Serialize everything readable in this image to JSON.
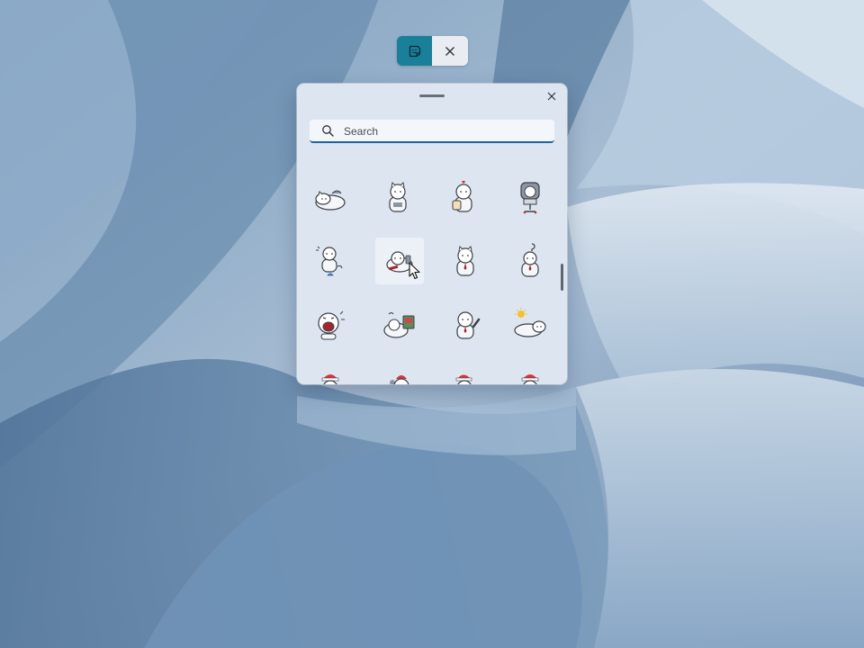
{
  "mode_toggle": {
    "active_icon": "sticker-icon",
    "close_icon": "close-icon"
  },
  "panel": {
    "close_icon": "close-icon",
    "search": {
      "placeholder": "Search",
      "value": ""
    }
  },
  "stickers": {
    "rows": [
      [
        "cat-sleeping-sticker",
        "cat-sitting-sticker",
        "cat-with-heart-sticker",
        "cat-office-chair-sticker"
      ],
      [
        "cat-with-bird-sticker",
        "cat-with-phone-sticker",
        "cat-tie-sticker",
        "cat-question-mark-sticker"
      ],
      [
        "cat-shouting-sticker",
        "cat-computer-sticker",
        "cat-waving-sticker",
        "cat-sun-sleeping-sticker"
      ],
      [
        "cat-santa-hat-sticker",
        "cat-santa-hat-sticker",
        "cat-santa-hat-sticker",
        "cat-santa-hat-sticker"
      ]
    ],
    "hovered": "cat-with-phone-sticker"
  },
  "colors": {
    "accent": "#1a7f98",
    "search_underline": "#1f5fa8",
    "panel_background": "#dde6f0"
  }
}
